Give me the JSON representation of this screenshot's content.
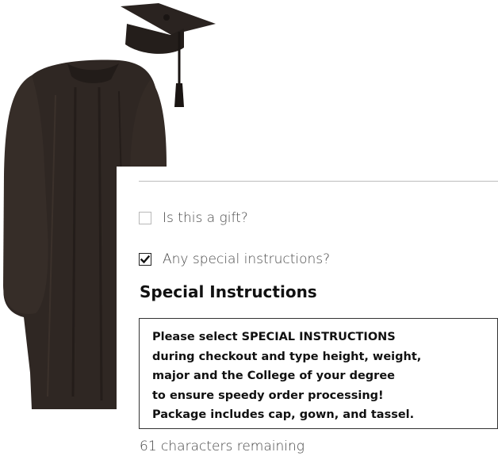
{
  "product": {
    "image_icon": "cap-gown-tassel-image"
  },
  "options": {
    "gift": {
      "label": "Is this a gift?",
      "checked": false
    },
    "special": {
      "label": "Any special instructions?",
      "checked": true
    }
  },
  "special_instructions": {
    "heading": "Special Instructions",
    "text": "Please select SPECIAL INSTRUCTIONS\nduring checkout and type height, weight,\nmajor and the College of your degree\nto ensure speedy order processing!\nPackage includes cap, gown, and tassel.",
    "remaining_text": "61 characters remaining"
  }
}
